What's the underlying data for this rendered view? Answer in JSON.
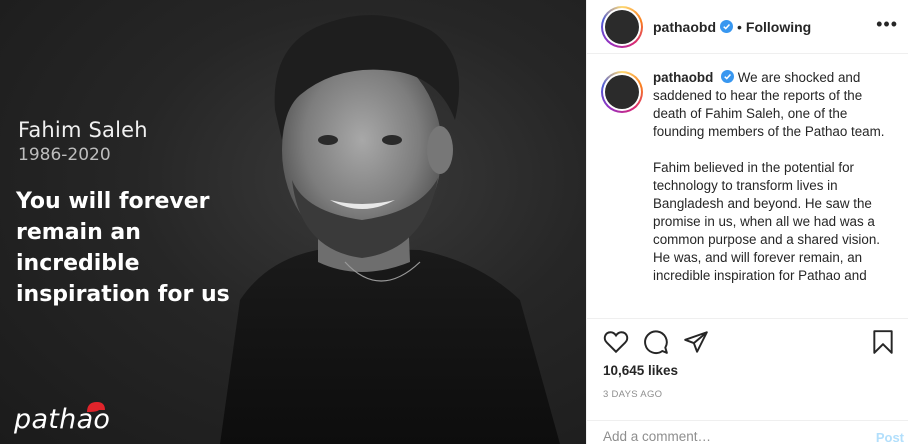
{
  "media": {
    "name": "Fahim Saleh",
    "years": "1986-2020",
    "tagline": "You will forever remain an incredible inspiration for us",
    "brand": "pathao"
  },
  "header": {
    "username": "pathaobd",
    "separator": "•",
    "follow_status": "Following",
    "more_icon": "more-horizontal-icon"
  },
  "caption": {
    "username": "pathaobd",
    "paragraphs": [
      "We are shocked and saddened to hear the reports of the death of Fahim Saleh, one of the founding members of the Pathao team.",
      "Fahim believed in the potential for technology to transform lives in Bangladesh and beyond. He saw the promise in us, when all we had was a common purpose and a shared vision. He was, and will forever remain, an incredible inspiration for Pathao and"
    ]
  },
  "actions": {
    "icons": [
      "heart-icon",
      "comment-icon",
      "share-icon",
      "bookmark-icon"
    ],
    "likes": "10,645 likes",
    "timestamp": "3 DAYS AGO"
  },
  "comment": {
    "placeholder": "Add a comment…",
    "post_label": "Post"
  },
  "colors": {
    "verified": "#3897f0",
    "post_disabled": "#b2dffc",
    "muted": "#8e8e8e"
  }
}
